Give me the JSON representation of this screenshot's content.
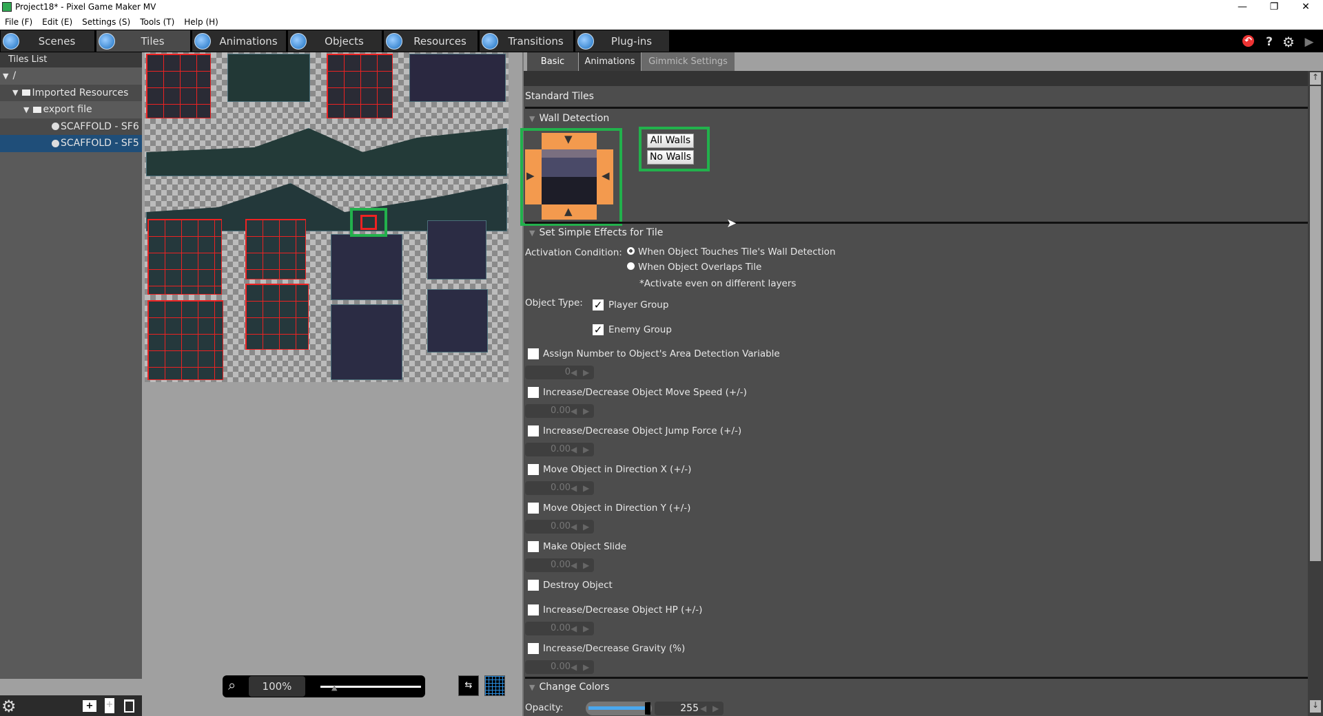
{
  "window": {
    "title": "Project18* - Pixel Game Maker MV",
    "minimize": "—",
    "restore": "❐",
    "close": "✕"
  },
  "menu": [
    "File (F)",
    "Edit (E)",
    "Settings (S)",
    "Tools (T)",
    "Help (H)"
  ],
  "main_tabs": [
    {
      "label": "Scenes"
    },
    {
      "label": "Tiles",
      "active": true
    },
    {
      "label": "Animations"
    },
    {
      "label": "Objects"
    },
    {
      "label": "Resources"
    },
    {
      "label": "Transitions"
    },
    {
      "label": "Plug-ins"
    }
  ],
  "toolbar_icons": {
    "undo": "↶",
    "help": "?",
    "settings": "⚙",
    "play": "▶"
  },
  "tiles_list": {
    "title": "Tiles List",
    "root": "/",
    "imported": "Imported Resources",
    "folder": "export file",
    "items": [
      "SCAFFOLD - SF6",
      "SCAFFOLD - SF5"
    ],
    "selected": "SCAFFOLD - SF5"
  },
  "zoom": {
    "value": "100%",
    "slider_fraction": 0.15
  },
  "right_tabs": [
    "Basic",
    "Animations",
    "Gimmick Settings"
  ],
  "basic": {
    "standard_tiles": "Standard Tiles",
    "wall_detection": "Wall Detection",
    "all_walls": "All Walls",
    "no_walls": "No Walls",
    "simple_effects": "Set Simple Effects for Tile",
    "activation_label": "Activation Condition:",
    "activation_options": [
      "When Object Touches Tile's Wall Detection",
      "When Object Overlaps Tile"
    ],
    "activation_selected": 0,
    "activation_note": "*Activate even on different layers",
    "object_type_label": "Object Type:",
    "object_types": [
      {
        "label": "Player Group",
        "checked": true
      },
      {
        "label": "Enemy Group",
        "checked": true
      }
    ],
    "effects": [
      {
        "label": "Assign Number to Object's Area Detection Variable",
        "checked": false,
        "value": "0"
      },
      {
        "label": "Increase/Decrease Object Move Speed (+/-)",
        "checked": false,
        "value": "0.00"
      },
      {
        "label": "Increase/Decrease Object Jump Force (+/-)",
        "checked": false,
        "value": "0.00"
      },
      {
        "label": "Move Object in Direction X (+/-)",
        "checked": false,
        "value": "0.00"
      },
      {
        "label": "Move Object in Direction Y (+/-)",
        "checked": false,
        "value": "0.00"
      },
      {
        "label": "Make Object Slide",
        "checked": false,
        "value": "0.00"
      },
      {
        "label": "Destroy Object",
        "checked": false
      },
      {
        "label": "Increase/Decrease Object HP (+/-)",
        "checked": false,
        "value": "0.00"
      },
      {
        "label": "Increase/Decrease Gravity (%)",
        "checked": false,
        "value": "0.00"
      }
    ],
    "change_colors": "Change Colors",
    "opacity_label": "Opacity:",
    "opacity_value": "255",
    "opacity_max": 255
  },
  "colors": {
    "accent": "#1f4e79",
    "highlight": "#22b14c",
    "wall": "#f39a4e"
  }
}
